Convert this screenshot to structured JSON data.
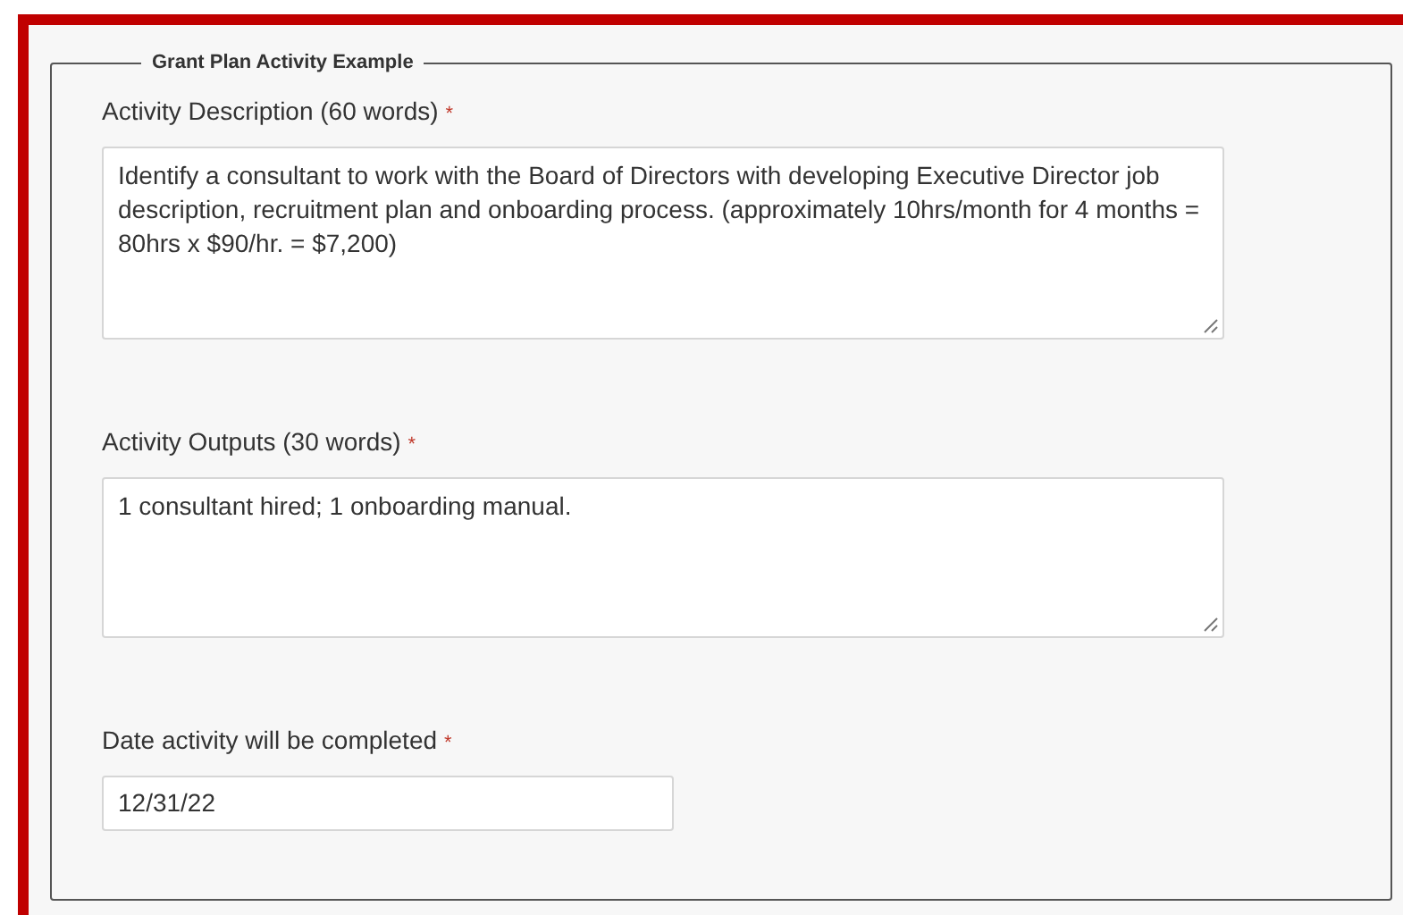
{
  "section": {
    "legend": "Grant Plan Activity Example"
  },
  "fields": [
    {
      "kind": "textarea",
      "label": "Activity Description (60 words)",
      "required_mark": "*",
      "value": "Identify a consultant to work with the Board of Directors with developing Executive Director job description, recruitment plan and onboarding process. (approximately 10hrs/month for 4 months = 80hrs x $90/hr. = $7,200)"
    },
    {
      "kind": "textarea",
      "label": "Activity Outputs (30 words)",
      "required_mark": "*",
      "value": "1 consultant hired; 1 onboarding manual."
    },
    {
      "kind": "input",
      "label": "Date activity will be completed",
      "required_mark": "*",
      "value": "12/31/22"
    }
  ]
}
